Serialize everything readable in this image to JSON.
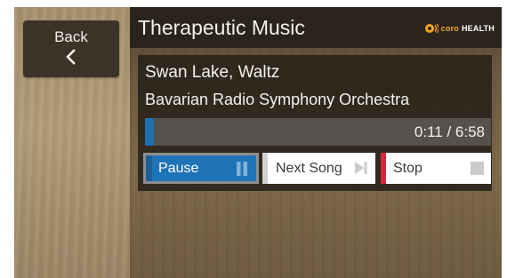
{
  "sidebar": {
    "back_label": "Back"
  },
  "header": {
    "title": "Therapeutic Music",
    "brand_coro": "coro",
    "brand_health": "HEALTH"
  },
  "player": {
    "song_title": "Swan Lake, Waltz",
    "artist": "Bavarian Radio Symphony Orchestra",
    "time_display": "0:11 / 6:58",
    "progress_fraction": 0.026
  },
  "controls": {
    "pause_label": "Pause",
    "next_label": "Next Song",
    "stop_label": "Stop"
  },
  "icons": {
    "back": "chevron-left-icon",
    "brand": "coro-health-logo-icon",
    "pause": "pause-icon",
    "next": "skip-next-icon",
    "stop": "stop-icon"
  },
  "colors": {
    "accent_blue": "#1f73b7",
    "stop_red": "#d8283e",
    "brand_orange": "#f2a51f",
    "header_dark": "#2b241c"
  }
}
